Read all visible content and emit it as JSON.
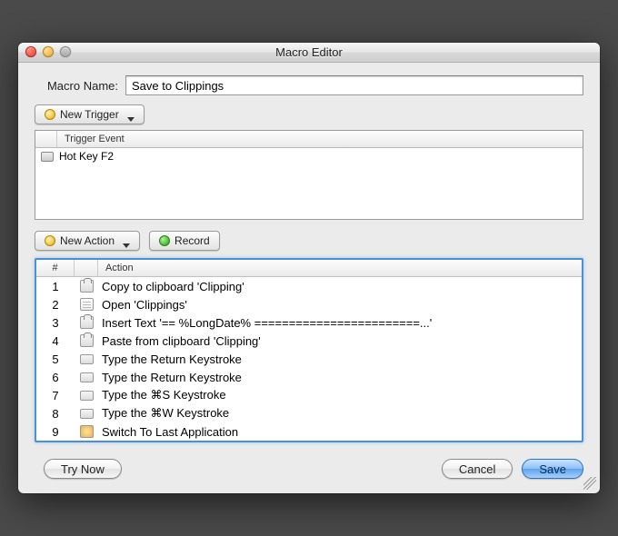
{
  "window": {
    "title": "Macro Editor"
  },
  "form": {
    "macro_name_label": "Macro Name:",
    "macro_name_value": "Save to Clippings"
  },
  "buttons": {
    "new_trigger": "New Trigger",
    "new_action": "New Action",
    "record": "Record",
    "try_now": "Try Now",
    "cancel": "Cancel",
    "save": "Save"
  },
  "trigger_list": {
    "header": "Trigger Event",
    "items": [
      {
        "label": "Hot Key F2",
        "icon": "keyboard-icon"
      }
    ]
  },
  "action_list": {
    "header_num": "#",
    "header_action": "Action",
    "items": [
      {
        "n": "1",
        "icon": "clip",
        "label": "Copy to clipboard 'Clipping'"
      },
      {
        "n": "2",
        "icon": "doc",
        "label": "Open 'Clippings'"
      },
      {
        "n": "3",
        "icon": "clip",
        "label": "Insert Text '== %LongDate% ========================...'"
      },
      {
        "n": "4",
        "icon": "clip",
        "label": "Paste from clipboard 'Clipping'"
      },
      {
        "n": "5",
        "icon": "kbd",
        "label": "Type the Return Keystroke"
      },
      {
        "n": "6",
        "icon": "kbd",
        "label": "Type the Return Keystroke"
      },
      {
        "n": "7",
        "icon": "kbd",
        "label": "Type the ⌘S Keystroke"
      },
      {
        "n": "8",
        "icon": "kbd",
        "label": "Type the ⌘W Keystroke"
      },
      {
        "n": "9",
        "icon": "switch",
        "label": "Switch To Last Application"
      }
    ]
  }
}
